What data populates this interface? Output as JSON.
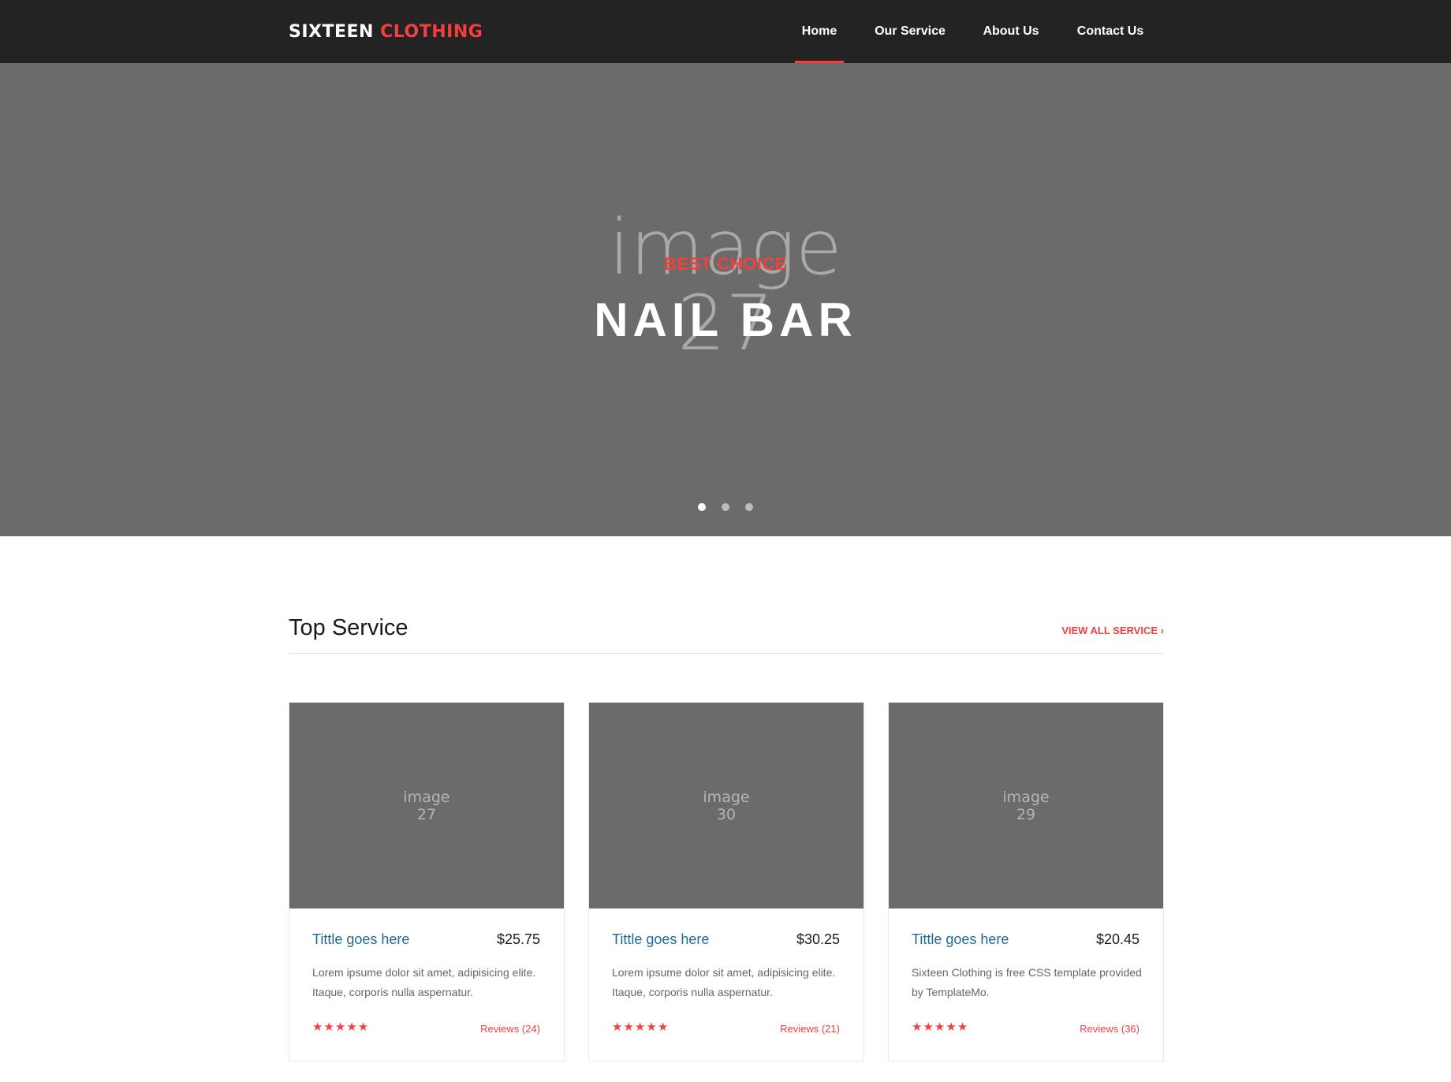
{
  "brand": {
    "name_part1": "SIXTEEN",
    "name_part2": "CLOTHING",
    "accent_color": "#f33f3f"
  },
  "nav": {
    "items": [
      {
        "label": "Home",
        "active": true
      },
      {
        "label": "Our Service",
        "active": false
      },
      {
        "label": "About Us",
        "active": false
      },
      {
        "label": "Contact Us",
        "active": false
      }
    ]
  },
  "hero": {
    "placeholder_word": "image",
    "placeholder_number": "27",
    "subtitle": "BEST CHOICE",
    "title": "NAIL BAR",
    "slides_count": 3,
    "active_slide": 1
  },
  "section": {
    "title": "Top Service",
    "view_all": "VIEW ALL SERVICE",
    "view_all_icon": "chevron-right-icon"
  },
  "cards": [
    {
      "image_word": "image",
      "image_number": "27",
      "title": "Tittle goes here",
      "price": "$25.75",
      "description": "Lorem ipsume dolor sit amet, adipisicing elite. Itaque, corporis nulla aspernatur.",
      "rating": 5,
      "reviews": "Reviews (24)"
    },
    {
      "image_word": "image",
      "image_number": "30",
      "title": "Tittle goes here",
      "price": "$30.25",
      "description": "Lorem ipsume dolor sit amet, adipisicing elite. Itaque, corporis nulla aspernatur.",
      "rating": 5,
      "reviews": "Reviews (21)"
    },
    {
      "image_word": "image",
      "image_number": "29",
      "title": "Tittle goes here",
      "price": "$20.45",
      "description": "Sixteen Clothing is free CSS template provided by TemplateMo.",
      "rating": 5,
      "reviews": "Reviews (36)"
    }
  ]
}
